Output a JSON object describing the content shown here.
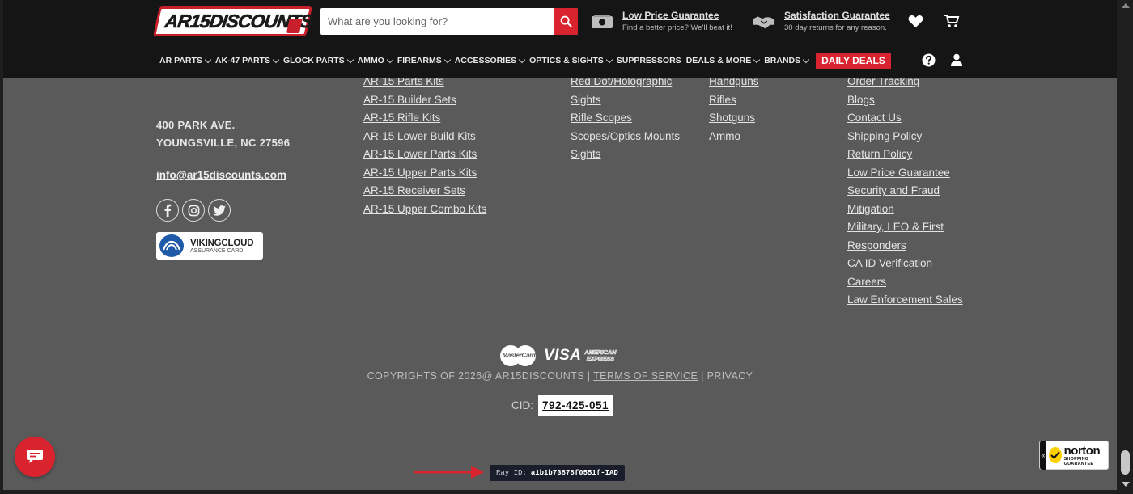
{
  "header": {
    "logo_text": "AR15DISCOUNTS",
    "logo_suffix": ".com",
    "search": {
      "placeholder": "What are you looking for?"
    },
    "guarantees": [
      {
        "title": "Low Price Guarantee",
        "subtitle": "Find a better price? We'll beat it!",
        "icon": "cash-icon"
      },
      {
        "title": "Satisfaction Guarantee",
        "subtitle": "30 day returns for any reason.",
        "icon": "handshake-icon"
      }
    ],
    "icons": [
      "heart-icon",
      "cart-icon",
      "help-icon",
      "user-icon"
    ]
  },
  "nav": {
    "items": [
      {
        "label": "AR PARTS",
        "dropdown": true
      },
      {
        "label": "AK-47 PARTS",
        "dropdown": true
      },
      {
        "label": "GLOCK PARTS",
        "dropdown": true
      },
      {
        "label": "AMMO",
        "dropdown": true
      },
      {
        "label": "FIREARMS",
        "dropdown": true
      },
      {
        "label": "ACCESSORIES",
        "dropdown": true
      },
      {
        "label": "OPTICS & SIGHTS",
        "dropdown": true
      },
      {
        "label": "SUPPRESSORS",
        "dropdown": false
      },
      {
        "label": "DEALS & MORE",
        "dropdown": true
      },
      {
        "label": "BRANDS",
        "dropdown": true
      }
    ],
    "daily_deals": "DAILY DEALS"
  },
  "footer": {
    "address_line1": "400 PARK AVE.",
    "address_line2": "YOUNGSVILLE, NC 27596",
    "email": "info@ar15discounts.com",
    "social": [
      "facebook-icon",
      "instagram-icon",
      "twitter-icon"
    ],
    "badge": {
      "title": "VIKINGCLOUD",
      "subtitle": "ASSURANCE CARD"
    },
    "columns": [
      [
        "AR-15 Parts Kits",
        "AR-15 Builder Sets",
        "AR-15 Rifle Kits",
        "AR-15 Lower Build Kits",
        "AR-15 Lower Parts Kits",
        "AR-15 Upper Parts Kits",
        "AR-15 Receiver Sets",
        "AR-15 Upper Combo Kits"
      ],
      [
        "Red Dot/Holographic",
        "Sights",
        "Rifle Scopes",
        "Scopes/Optics Mounts",
        "Sights"
      ],
      [
        "Handguns",
        "Rifles",
        "Shotguns",
        "Ammo"
      ],
      [
        "Order Tracking",
        "Blogs",
        "Contact Us",
        "Shipping Policy",
        "Return Policy",
        "Low Price Guarantee",
        "Security and Fraud",
        "Mitigation",
        "Military, LEO & First",
        "Responders",
        "CA ID Verification",
        "Careers",
        "Law Enforcement Sales"
      ]
    ],
    "payment": {
      "mastercard": "MasterCard",
      "visa": "VISA",
      "amex_line1": "AMERICAN",
      "amex_line2": "EXPRESS"
    },
    "copyright": {
      "prefix": "COPYRIGHTS OF 2026@ AR15DISCOUNTS | ",
      "terms": "TERMS OF SERVICE",
      "sep": " | ",
      "privacy": "PRIVACY"
    },
    "cid_label": "CID:",
    "cid_value": "792-425-051",
    "ray_label": "Ray ID:",
    "ray_value": "a1b1b73878f0551f-IAD",
    "norton": {
      "title": "norton",
      "subtitle": "SHOPPING GUARANTEE",
      "tab": "«"
    }
  },
  "colors": {
    "accent": "#d9232e",
    "header_bg": "#151515",
    "footer_bg": "#5a5a5a"
  }
}
